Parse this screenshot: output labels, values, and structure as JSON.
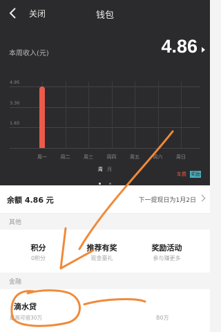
{
  "header": {
    "close_label": "关闭",
    "title": "钱包"
  },
  "earnings": {
    "label": "本周收入(元)",
    "value": "4.86"
  },
  "chart_data": {
    "type": "bar",
    "categories": [
      "周一",
      "周二",
      "周三",
      "周四",
      "周五",
      "周六",
      "周日"
    ],
    "values": [
      4.95,
      0,
      0,
      0,
      0,
      0,
      0
    ],
    "y_ticks": [
      "4.95",
      "3.30",
      "1.65"
    ],
    "ylim": [
      0,
      4.95
    ],
    "legend": [
      "车费",
      "奖励"
    ],
    "colors": {
      "bar": "#ec5a4a",
      "legend_fare": "#ec5a4a",
      "legend_reward": "#46b7c7"
    }
  },
  "period_toggle": {
    "week": "周",
    "month": "月"
  },
  "balance": {
    "label": "余额 4.86 元",
    "next_withdraw": "下一提现日为1月2日"
  },
  "sections": {
    "other": "其他",
    "finance": "金融"
  },
  "other_items": [
    {
      "title": "积分",
      "subtitle": "0积分"
    },
    {
      "title": "推荐有奖",
      "subtitle": "现金豪礼"
    },
    {
      "title": "奖励活动",
      "subtitle": "参与赚更多"
    }
  ],
  "loan": {
    "title": "滴水贷",
    "subtitle": "最高可借30万",
    "right_text": "B0万"
  },
  "annotation": {
    "color": "#f08a3a"
  }
}
